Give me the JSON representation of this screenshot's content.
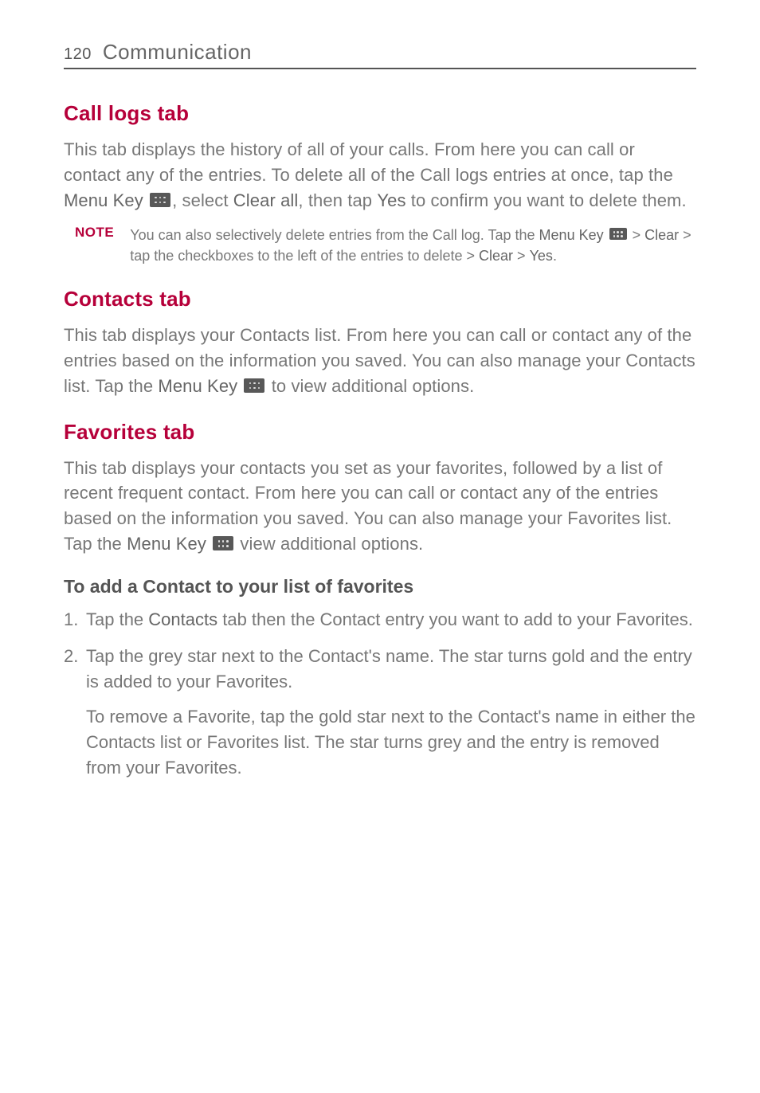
{
  "header": {
    "page_number": "120",
    "title": "Communication"
  },
  "sections": {
    "call_logs": {
      "heading": "Call logs tab",
      "p1_a": "This tab displays the history of all of your calls. From here you can call or contact any of the entries. To delete all of the Call logs entries at once, tap the ",
      "menu_key": "Menu Key",
      "p1_b": ", select ",
      "clear_all": "Clear all",
      "p1_c": ", then tap ",
      "yes": "Yes",
      "p1_d": " to confirm you want to delete them.",
      "note_label": "NOTE",
      "note_a": "You can also selectively delete entries from the Call log. Tap the ",
      "note_menu_key": "Menu Key",
      "note_b": "  > ",
      "note_clear": "Clear",
      "note_c": " > tap the checkboxes to the left of the entries to delete > ",
      "note_clear2": "Clear",
      "note_d": " > ",
      "note_yes": "Yes",
      "note_e": "."
    },
    "contacts": {
      "heading": "Contacts tab",
      "p1_a": "This tab displays your Contacts list. From here you can call or contact any of the entries based on the information you saved.  You can also manage your Contacts list. Tap the ",
      "menu_key": "Menu Key",
      "p1_b": " to view additional options."
    },
    "favorites": {
      "heading": "Favorites tab",
      "p1_a": "This tab displays your contacts you set as your favorites, followed by a list of recent frequent contact. From here you can call or contact any of the entries based on the information you saved. You can also manage your Favorites list. Tap the ",
      "menu_key": "Menu Key",
      "p1_b": " view additional options.",
      "sub_heading": "To add a Contact to your list of favorites",
      "li1_a": "Tap the ",
      "li1_contacts": "Contacts",
      "li1_b": " tab then the Contact entry you want to add to your Favorites.",
      "li2": "Tap the grey star next to the Contact's name. The star turns gold and the entry is added to your Favorites.",
      "follow": "To remove a Favorite, tap the gold star next to the Contact's name in either the Contacts list or Favorites list. The star turns grey and the entry is removed from your Favorites."
    }
  }
}
